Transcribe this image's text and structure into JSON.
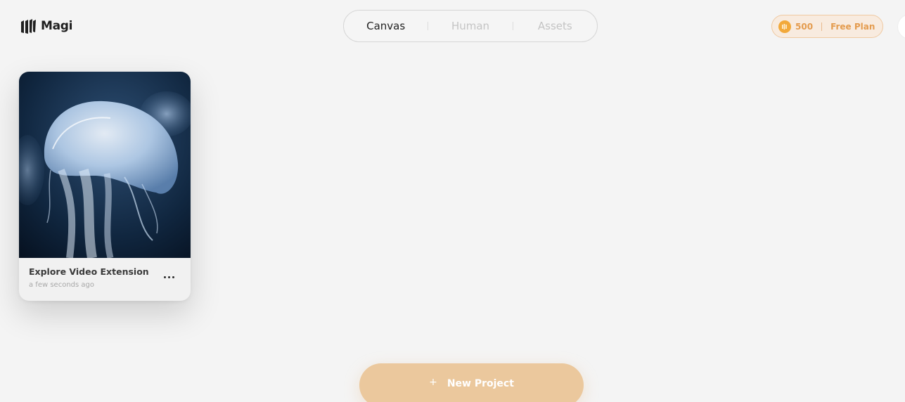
{
  "app": {
    "name": "Magi"
  },
  "tabs": [
    {
      "label": "Canvas",
      "active": true
    },
    {
      "label": "Human",
      "active": false
    },
    {
      "label": "Assets",
      "active": false
    }
  ],
  "credits": {
    "amount": "500",
    "plan": "Free Plan",
    "icon": "coin-icon"
  },
  "projects": [
    {
      "title": "Explore Video Extension",
      "time": "a few seconds ago",
      "thumbnail": "jellyfish-image"
    }
  ],
  "new_project": {
    "label": "New Project",
    "icon": "plus-icon"
  },
  "colors": {
    "background": "#f4f4f4",
    "accent": "#ebc89d",
    "credits_text": "#e49c4f"
  }
}
